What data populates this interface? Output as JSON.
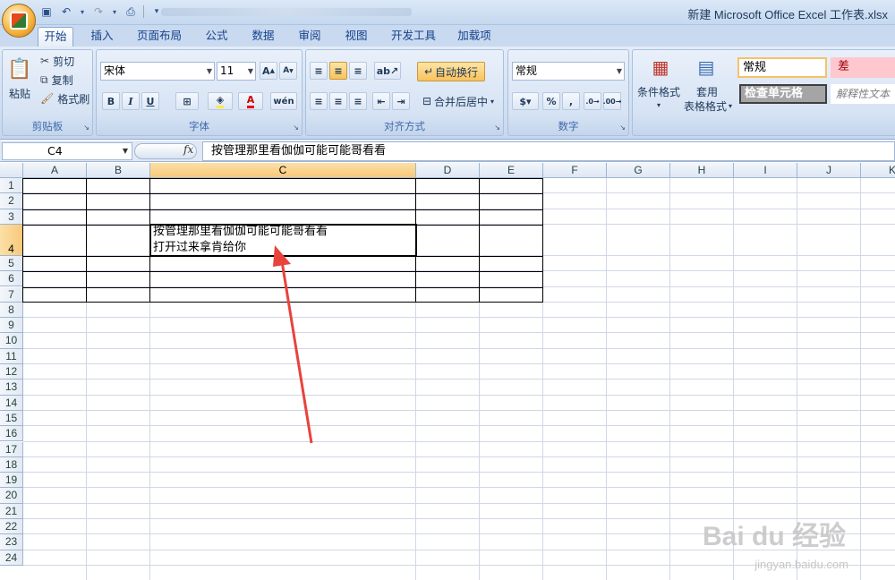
{
  "window": {
    "title": "新建 Microsoft Office Excel 工作表.xlsx"
  },
  "tabs": [
    "开始",
    "插入",
    "页面布局",
    "公式",
    "数据",
    "审阅",
    "视图",
    "开发工具",
    "加载项"
  ],
  "clipboard": {
    "paste": "粘贴",
    "cut": "剪切",
    "copy": "复制",
    "format_painter": "格式刷",
    "label": "剪贴板"
  },
  "font": {
    "name": "宋体",
    "size": "11",
    "label": "字体",
    "bold": "B",
    "italic": "I",
    "underline": "U"
  },
  "alignment": {
    "wrap_text": "自动换行",
    "merge_center": "合并后居中",
    "label": "对齐方式"
  },
  "number": {
    "format": "常规",
    "percent": "%",
    "comma": ",",
    "label": "数字"
  },
  "styles": {
    "cond_format": "条件格式",
    "table_format_1": "套用",
    "table_format_2": "表格格式",
    "normal": "常规",
    "bad": "差",
    "check_cell": "检查单元格",
    "explanatory": "解释性文本"
  },
  "formula_bar": {
    "name_box": "C4",
    "fx": "fx",
    "content": "按管理那里看伽伽可能可能哥看看"
  },
  "columns": [
    "A",
    "B",
    "C",
    "D",
    "E",
    "F",
    "G",
    "H",
    "I",
    "J",
    "K"
  ],
  "rows": [
    "1",
    "2",
    "3",
    "4",
    "5",
    "6",
    "7",
    "8",
    "9",
    "10",
    "11",
    "12",
    "13",
    "14",
    "15",
    "16",
    "17",
    "18",
    "19",
    "20",
    "21",
    "22",
    "23",
    "24"
  ],
  "cell_c4": {
    "line1": "按管理那里看伽伽可能可能哥看看",
    "line2": "打开过来拿肯给你"
  },
  "watermark": {
    "brand": "Bai du 经验",
    "url": "jingyan.baidu.com"
  },
  "colors": {
    "accent": "#f8c97a",
    "arrow": "#e8433d",
    "ribbon": "#d0def0"
  }
}
